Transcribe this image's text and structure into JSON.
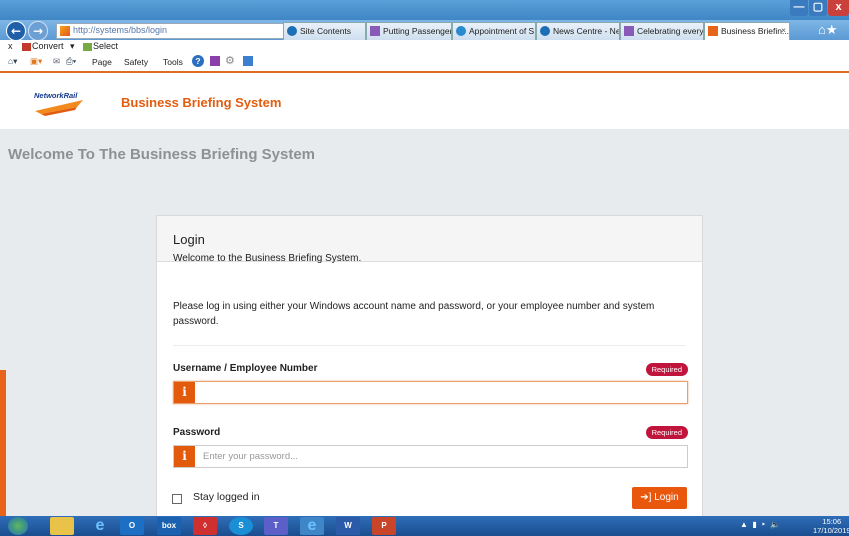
{
  "browser": {
    "address_url": "http://systems/bbs/login",
    "address_controls": "⌕ ▾ ↻",
    "tabs": [
      {
        "label": "Site Contents",
        "icon": "sharepoint-icon",
        "color": "#1c6fb5"
      },
      {
        "label": "Putting Passenger...",
        "icon": "networkrail-icon",
        "color": "#8a5ab8"
      },
      {
        "label": "Appointment of S...",
        "icon": "ie-icon",
        "color": "#2a8ad0"
      },
      {
        "label": "News Centre - Ne...",
        "icon": "sharepoint-icon",
        "color": "#1c6fb5"
      },
      {
        "label": "Celebrating every...",
        "icon": "networkrail-icon",
        "color": "#8a5ab8"
      },
      {
        "label": "Business Briefin...",
        "icon": "networkrail-icon",
        "color": "#e8641a",
        "active": true
      }
    ],
    "close_x": "×",
    "toolbar1": {
      "close": "x",
      "convert": "Convert",
      "select": "Select"
    },
    "toolbar2": {
      "page": "Page",
      "safety": "Safety",
      "tools": "Tools"
    }
  },
  "header": {
    "logo_text": "NetworkRail",
    "app_name": "Business Briefing System"
  },
  "page": {
    "welcome_heading": "Welcome To The Business Briefing System"
  },
  "login": {
    "title": "Login",
    "intro": "Welcome to the Business Briefing System.",
    "instructions": "Please log in using either your Windows account name and password, or your employee number and system password.",
    "username_label": "Username / Employee Number",
    "username_value": "",
    "password_label": "Password",
    "password_placeholder": "Enter your password...",
    "required_badge": "Required",
    "info_glyph": "i",
    "stay_logged_in": "Stay logged in",
    "login_button": "➔] Login"
  },
  "taskbar": {
    "time": "15:06",
    "date": "17/10/2019"
  },
  "colors": {
    "accent_orange": "#e8570c",
    "required_red": "#c1143d",
    "brand_blue": "#173a8e"
  }
}
